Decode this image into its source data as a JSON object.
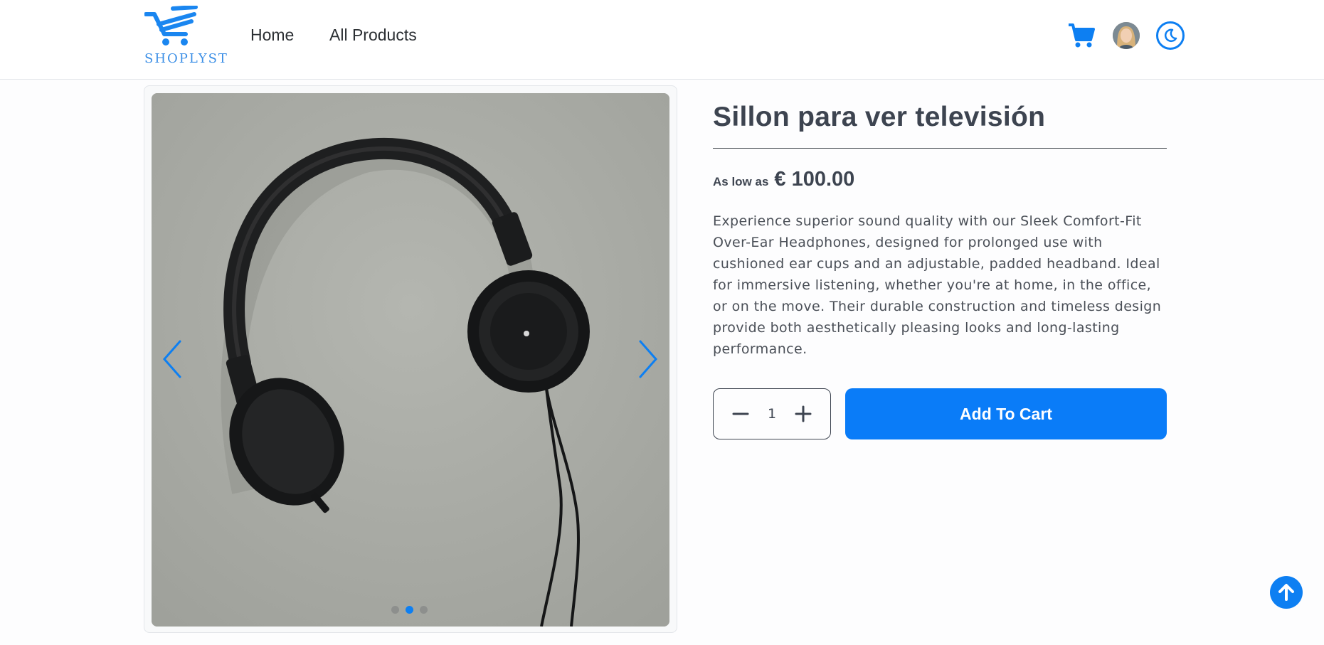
{
  "brand": {
    "name": "SHOPLYST",
    "logo_icon": "shopping-cart-logo-icon"
  },
  "nav": {
    "home_label": "Home",
    "products_label": "All Products"
  },
  "header_icons": {
    "cart": "cart-icon",
    "avatar": "user-avatar",
    "theme_toggle": "moon-icon"
  },
  "product": {
    "title": "Sillon para ver televisión",
    "price_prefix": "As low as",
    "price": "€ 100.00",
    "description": "Experience superior sound quality with our Sleek Comfort-Fit Over-Ear Headphones, designed for prolonged use with cushioned ear cups and an adjustable, padded headband. Ideal for immersive listening, whether you're at home, in the office, or on the move. Their durable construction and timeless design provide both aesthetically pleasing looks and long-lasting performance.",
    "quantity": "1",
    "add_to_cart_label": "Add To Cart"
  },
  "carousel": {
    "slide_count": 3,
    "active_index": 1
  },
  "colors": {
    "accent": "#0a7cf8",
    "text": "#3d4450"
  }
}
